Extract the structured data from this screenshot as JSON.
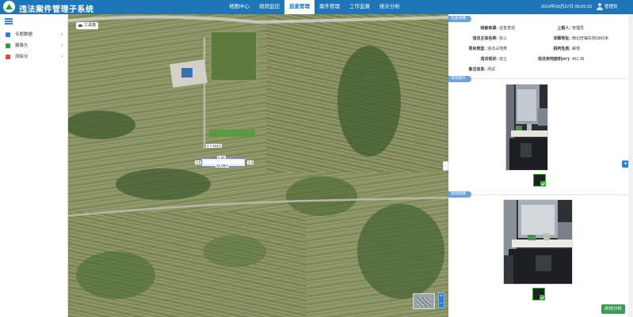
{
  "app": {
    "title": "违法案件管理子系统"
  },
  "nav": {
    "items": [
      "地图中心",
      "视频监控",
      "巡查管理",
      "案件管理",
      "工作监督",
      "统计分析"
    ],
    "active_index": 2
  },
  "header": {
    "datetime": "2019年03月27日 09:05:33",
    "user": "管理员"
  },
  "sidebar": {
    "items": [
      {
        "label": "专题数据",
        "icon": "folder-icon",
        "color": "#2a7fd4"
      },
      {
        "label": "摄像头",
        "icon": "camera-icon",
        "color": "#2e9d4a"
      },
      {
        "label": "测绘仪",
        "icon": "instrument-icon",
        "color": "#e14a3a"
      }
    ]
  },
  "map": {
    "chip_label": "工具箱",
    "measure_labels": [
      "4.7.33(1)",
      "0.26",
      "42.08m",
      "1:0",
      "1.0"
    ]
  },
  "panel": {
    "sections": {
      "info": "巡查详情",
      "photos1": "现场照片",
      "photos2": "现场视频"
    },
    "fields": [
      {
        "key": "线索来源:",
        "value": "巡查发现"
      },
      {
        "key": "上报人:",
        "value": "管理员"
      },
      {
        "key": "违法主体名称:",
        "value": "张三"
      },
      {
        "key": "详细地址:",
        "value": "西北旺镇东侧1800米"
      },
      {
        "key": "项目类型:",
        "value": "违法占地类"
      },
      {
        "key": "招判性质:",
        "value": "耕地"
      },
      {
        "key": "违法现状:",
        "value": "动土"
      },
      {
        "key": "违法用地面积(m²):",
        "value": "461.36"
      },
      {
        "key": "备注信息:",
        "value": "测试"
      }
    ],
    "analyze_button": "用地分析"
  },
  "colors": {
    "header": "#1e75b8",
    "section_tag": "#6fa3d6",
    "button_green": "#3a9c57"
  }
}
